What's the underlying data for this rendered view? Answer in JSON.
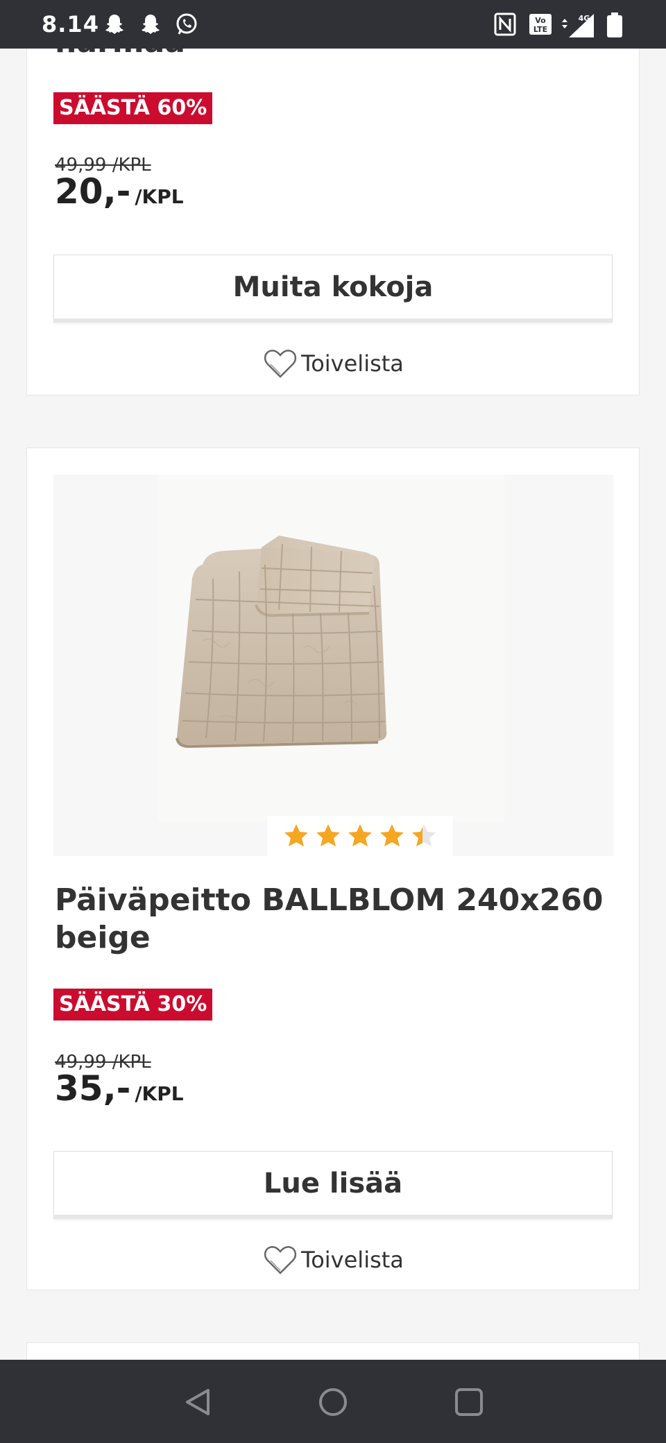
{
  "status_bar": {
    "time": "8.14",
    "icons": [
      "snapchat-icon",
      "snapchat-icon",
      "whatsapp-icon",
      "nfc-icon",
      "volte-icon",
      "4g-signal-icon",
      "battery-icon"
    ],
    "network_label": "4G"
  },
  "cards": [
    {
      "title_partial": "harmaa",
      "badge": "SÄÄSTÄ 60%",
      "old_price": "49,99 /KPL",
      "price": "20,-",
      "price_unit": "/KPL",
      "button_label": "Muita kokoja",
      "wishlist_label": "Toivelista"
    },
    {
      "image_alt": "Beige quilted bedspread",
      "rating": 4.5,
      "rating_max": 5,
      "name": "Päiväpeitto BALLBLOM 240x260 beige",
      "badge": "SÄÄSTÄ 30%",
      "old_price": "49,99 /KPL",
      "price": "35,-",
      "price_unit": "/KPL",
      "button_label": "Lue lisää",
      "wishlist_label": "Toivelista"
    }
  ],
  "colors": {
    "badge_red": "#cc0c2f",
    "star_gold": "#f5a623",
    "system_bar": "#2f3136"
  },
  "nav_bar": {
    "buttons": [
      "back-icon",
      "home-icon",
      "recents-icon"
    ]
  }
}
